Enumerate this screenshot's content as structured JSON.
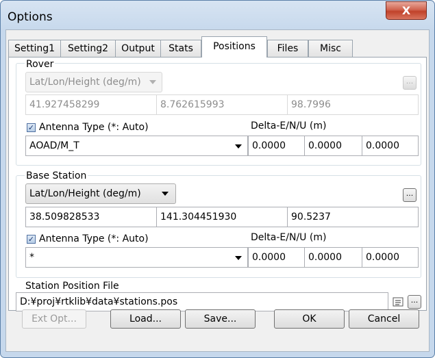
{
  "window": {
    "title": "Options",
    "close_glyph": "X"
  },
  "tabs": [
    {
      "label": "Setting1"
    },
    {
      "label": "Setting2"
    },
    {
      "label": "Output"
    },
    {
      "label": "Stats"
    },
    {
      "label": "Positions",
      "active": true
    },
    {
      "label": "Files"
    },
    {
      "label": "Misc"
    }
  ],
  "rover": {
    "group_label": "Rover",
    "format": "Lat/Lon/Height (deg/m)",
    "pos": [
      "41.927458299",
      "8.762615993",
      "98.7996"
    ],
    "antenna_label": "Antenna Type (*: Auto)",
    "antenna_checked": true,
    "delta_label": "Delta-E/N/U (m)",
    "antenna_type": "AOAD/M_T",
    "delta": [
      "0.0000",
      "0.0000",
      "0.0000"
    ]
  },
  "base": {
    "group_label": "Base Station",
    "format": "Lat/Lon/Height (deg/m)",
    "pos": [
      "38.509828533",
      "141.304451930",
      "90.5237"
    ],
    "antenna_label": "Antenna Type (*: Auto)",
    "antenna_checked": true,
    "delta_label": "Delta-E/N/U (m)",
    "antenna_type": "*",
    "delta": [
      "0.0000",
      "0.0000",
      "0.0000"
    ]
  },
  "station_file": {
    "label": "Station Position File",
    "path": "D:¥proj¥rtklib¥data¥stations.pos"
  },
  "icons": {
    "browse": "...",
    "view_file": "list-icon"
  },
  "buttons": {
    "ext_opt": "Ext Opt...",
    "load": "Load...",
    "save": "Save...",
    "ok": "OK",
    "cancel": "Cancel"
  }
}
